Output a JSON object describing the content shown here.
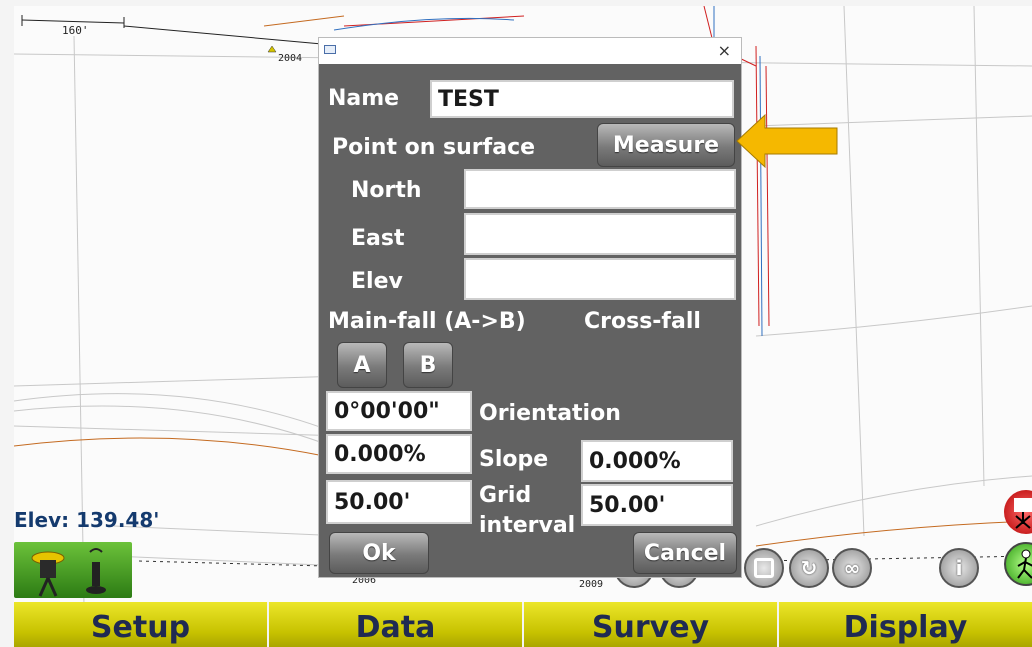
{
  "map": {
    "scale_label": "160'",
    "point_labels": [
      "2004",
      "2006",
      "2009"
    ],
    "elev_readout": "Elev: 139.48'"
  },
  "dialog": {
    "name_label": "Name",
    "name_value": "TEST",
    "point_on_surface_label": "Point on surface",
    "measure_button": "Measure",
    "north_label": "North",
    "north_value": "",
    "east_label": "East",
    "east_value": "",
    "elev_label": "Elev",
    "elev_value": "",
    "main_fall_label": "Main-fall (A->B)",
    "cross_fall_label": "Cross-fall",
    "a_button": "A",
    "b_button": "B",
    "orientation_value": "0°00'00\"",
    "orientation_label": "Orientation",
    "slope_main_value": "0.000%",
    "slope_label": "Slope",
    "slope_cross_value": "0.000%",
    "grid_main_value": "50.00'",
    "grid_label": "Grid interval",
    "grid_cross_value": "50.00'",
    "ok_button": "Ok",
    "cancel_button": "Cancel",
    "close_glyph": "×"
  },
  "toolbar": {
    "info_glyph": "i",
    "loop_glyph": "∞"
  },
  "bottom_menu": [
    "Setup",
    "Data",
    "Survey",
    "Display"
  ],
  "colors": {
    "dialog_bg": "#626262",
    "menu_bar": "#c7c200",
    "menu_text": "#1f2a52",
    "elev_text": "#143a6e",
    "arrow": "#f5b800",
    "gnss_status": "#2c7b14"
  }
}
